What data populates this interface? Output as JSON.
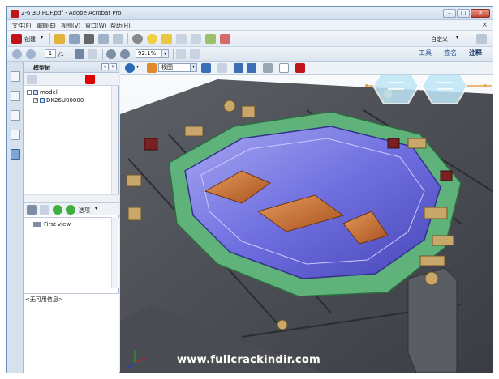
{
  "window": {
    "title": "2-6 3D PDF.pdf - Adobe Acrobat Pro",
    "minimize": "–",
    "maximize": "□",
    "close": "✕"
  },
  "menu": {
    "items": [
      "文件(F)",
      "编辑(E)",
      "视图(V)",
      "窗口(W)",
      "帮助(H)"
    ],
    "close_glyph": "×"
  },
  "toolbar": {
    "create_label": "创建",
    "customize_label": "自定义",
    "page_current": "1",
    "page_total": "/1",
    "zoom_value": "92.1%"
  },
  "right_tabs": [
    "工具",
    "签名",
    "注释"
  ],
  "panel": {
    "title": "模型树",
    "tree": {
      "root": "model",
      "child": "DK26U00000"
    },
    "views_label": "选项",
    "views": [
      "First view"
    ],
    "info_text": "<无可用信息>"
  },
  "viewer3d": {
    "view_select": "视图"
  },
  "watermark": "www.fullcrackindir.com",
  "colors": {
    "accent_red": "#c0141a",
    "die_blue": "#6f6fe0",
    "die_green": "#5fb37a",
    "copper": "#c86a35"
  },
  "icons": {
    "left_sidebar": [
      "pages-icon",
      "bookmarks-icon",
      "attachments-icon",
      "signatures-icon",
      "model-tree-icon"
    ]
  }
}
